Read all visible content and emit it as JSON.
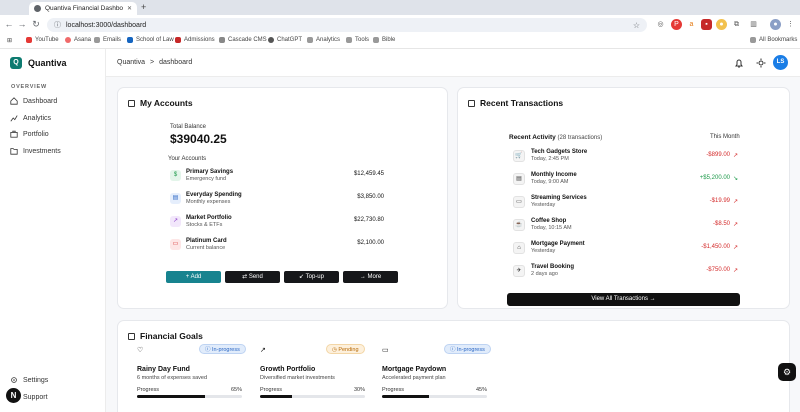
{
  "browser": {
    "tab_title": "Quantiva Financial Dashboard",
    "url": "localhost:3000/dashboard",
    "bookmarks": [
      "YouTube",
      "Asana",
      "Emails",
      "School of Law",
      "Admissions",
      "Cascade CMS",
      "ChatGPT",
      "Analytics",
      "Tools",
      "Bible"
    ],
    "all_bookmarks": "All Bookmarks"
  },
  "app": {
    "name": "Quantiva",
    "logo_letter": "Q"
  },
  "sidebar": {
    "section": "OVERVIEW",
    "items": [
      {
        "label": "Dashboard",
        "icon": "home-icon"
      },
      {
        "label": "Analytics",
        "icon": "chart-icon"
      },
      {
        "label": "Portfolio",
        "icon": "briefcase-icon"
      },
      {
        "label": "Investments",
        "icon": "folder-icon"
      }
    ],
    "bottom": [
      {
        "label": "Settings",
        "icon": "gear-icon"
      },
      {
        "label": "Support",
        "icon": "help-icon"
      }
    ]
  },
  "topbar": {
    "breadcrumb_root": "Quantiva",
    "breadcrumb_sep": ">",
    "breadcrumb_page": "dashboard",
    "avatar": "LS"
  },
  "accounts": {
    "title": "My Accounts",
    "total_label": "Total Balance",
    "total_value": "$39040.25",
    "your_accounts": "Your Accounts",
    "list": [
      {
        "name": "Primary Savings",
        "sub": "Emergency fund",
        "amount": "$12,459.45",
        "icon": "savings-icon",
        "color": "#e3f5ea"
      },
      {
        "name": "Everyday Spending",
        "sub": "Monthly expenses",
        "amount": "$3,850.00",
        "icon": "wallet-icon",
        "color": "#e5eefc"
      },
      {
        "name": "Market Portfolio",
        "sub": "Stocks & ETFs",
        "amount": "$22,730.80",
        "icon": "chart-icon",
        "color": "#f2e7fb"
      },
      {
        "name": "Platinum Card",
        "sub": "Current balance",
        "amount": "$2,100.00",
        "icon": "card-icon",
        "color": "#fde6e6"
      }
    ],
    "actions": [
      "Add",
      "Send",
      "Top-up",
      "More"
    ]
  },
  "transactions": {
    "title": "Recent Transactions",
    "recent_label": "Recent Activity",
    "count": "(28 transactions)",
    "period": "This Month",
    "list": [
      {
        "name": "Tech Gadgets Store",
        "time": "Today, 2:45 PM",
        "amount": "-$899.00",
        "type": "debit",
        "icon": "cart-icon"
      },
      {
        "name": "Monthly Income",
        "time": "Today, 9:00 AM",
        "amount": "+$5,200.00",
        "type": "credit",
        "icon": "wallet-icon"
      },
      {
        "name": "Streaming Services",
        "time": "Yesterday",
        "amount": "-$19.99",
        "type": "debit",
        "icon": "card-icon"
      },
      {
        "name": "Coffee Shop",
        "time": "Today, 10:15 AM",
        "amount": "-$8.50",
        "type": "debit",
        "icon": "coffee-icon"
      },
      {
        "name": "Mortgage Payment",
        "time": "Yesterday",
        "amount": "-$1,450.00",
        "type": "debit",
        "icon": "house-icon"
      },
      {
        "name": "Travel Booking",
        "time": "2 days ago",
        "amount": "-$750.00",
        "type": "debit",
        "icon": "plane-icon"
      }
    ],
    "view_all": "View All Transactions"
  },
  "goals": {
    "title": "Financial Goals",
    "list": [
      {
        "name": "Rainy Day Fund",
        "desc": "6 months of expenses saved",
        "status": "In-progress",
        "progress_label": "Progress",
        "progress": "65%",
        "fraction": 0.65,
        "icon": "piggy-icon"
      },
      {
        "name": "Growth Portfolio",
        "desc": "Diversified market investments",
        "status": "Pending",
        "progress_label": "Progress",
        "progress": "30%",
        "fraction": 0.3,
        "icon": "trend-icon"
      },
      {
        "name": "Mortgage Paydown",
        "desc": "Accelerated payment plan",
        "status": "In-progress",
        "progress_label": "Progress",
        "progress": "45%",
        "fraction": 0.45,
        "icon": "card-icon"
      }
    ]
  }
}
